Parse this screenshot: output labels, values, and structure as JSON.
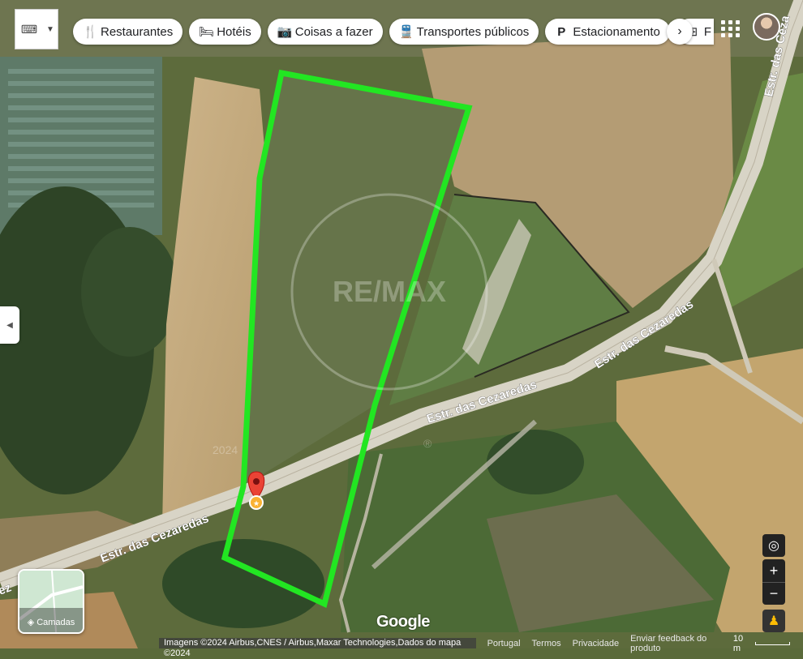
{
  "toolbar": {
    "chips": [
      {
        "label": "Restaurantes",
        "icon": "fork-knife-icon"
      },
      {
        "label": "Hotéis",
        "icon": "bed-icon"
      },
      {
        "label": "Coisas a fazer",
        "icon": "camera-icon"
      },
      {
        "label": "Transportes públicos",
        "icon": "train-icon"
      },
      {
        "label": "Estacionamento",
        "icon": "parking-icon"
      },
      {
        "label": "F",
        "icon": "pharmacy-icon"
      }
    ]
  },
  "map": {
    "road_labels": [
      "Estr. das Cezaredas",
      "Estr. das Cezaredas",
      "Estr. das Cezaredas",
      "Estr. das Ceza",
      "ez"
    ],
    "watermark": "RE/MAX",
    "watermark_year": "2024",
    "watermark_reg": "®",
    "outline_color": "#22e622",
    "pin_color": "#ea4335"
  },
  "layers": {
    "label": "Camadas"
  },
  "brand": "Google",
  "footer": {
    "attribution": "Imagens ©2024 Airbus,CNES / Airbus,Maxar Technologies,Dados do mapa ©2024",
    "links": [
      "Portugal",
      "Termos",
      "Privacidade",
      "Enviar feedback do produto"
    ],
    "scale": "10 m"
  }
}
